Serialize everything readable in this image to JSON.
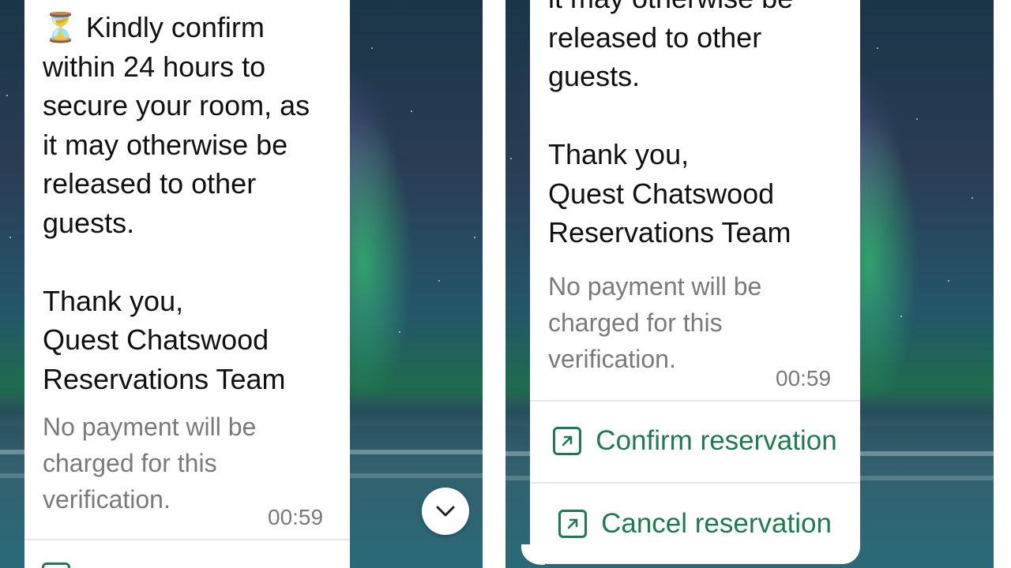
{
  "left_bubble": {
    "message": "⏳ Kindly confirm\nwithin 24 hours to\nsecure your room, as\nit may otherwise be\nreleased to other\nguests.\n\nThank you,\nQuest Chatswood\nReservations Team",
    "note": "No payment will be\ncharged for this\nverification.",
    "time": "00:59"
  },
  "right_bubble": {
    "message": "it may otherwise be\nreleased to other\nguests.\n\nThank you,\nQuest Chatswood\nReservations Team",
    "note": "No payment will be\ncharged for this\nverification.",
    "time": "00:59",
    "actions": [
      {
        "label": "Confirm reservation",
        "icon": "external-link-icon"
      },
      {
        "label": "Cancel reservation",
        "icon": "external-link-icon"
      }
    ]
  },
  "colors": {
    "action_green": "#1f7a52",
    "muted_text": "#7a7a7a",
    "bubble_bg": "#ffffff"
  }
}
